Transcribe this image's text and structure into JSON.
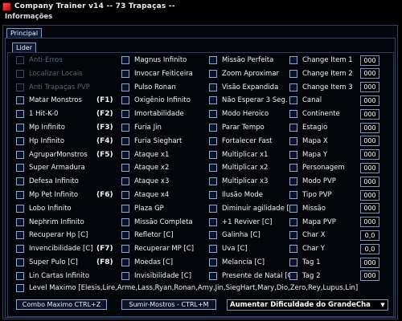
{
  "window": {
    "title": "Company Trainer v14 -- 73 Trapaças --"
  },
  "menu": {
    "info": "Informações"
  },
  "tabs": {
    "main": "Principal",
    "sub": "Lider"
  },
  "col1": [
    {
      "label": "Anti-Erros",
      "hotkey": "",
      "disabled": true
    },
    {
      "label": "Localizar Locais",
      "hotkey": "",
      "disabled": true
    },
    {
      "label": "Anti Trapaças PVP",
      "hotkey": "",
      "disabled": true
    },
    {
      "label": "Matar Monstros",
      "hotkey": "(F1)",
      "disabled": false
    },
    {
      "label": "1 Hit-K-0",
      "hotkey": "(F2)",
      "disabled": false
    },
    {
      "label": "Mp Infinito",
      "hotkey": "(F3)",
      "disabled": false
    },
    {
      "label": "Hp Infinito",
      "hotkey": "(F4)",
      "disabled": false
    },
    {
      "label": "AgruparMonstros",
      "hotkey": "(F5)",
      "disabled": false
    },
    {
      "label": "Super Armadura",
      "hotkey": "",
      "disabled": false
    },
    {
      "label": "Defesa Infinito",
      "hotkey": "",
      "disabled": false
    },
    {
      "label": "Mp Pet Infinito",
      "hotkey": "(F6)",
      "disabled": false
    },
    {
      "label": "Lobo Infinito",
      "hotkey": "",
      "disabled": false
    },
    {
      "label": "Nephrim Infinito",
      "hotkey": "",
      "disabled": false
    },
    {
      "label": "Recuperar Hp [C]",
      "hotkey": "",
      "disabled": false
    },
    {
      "label": "Invencibilidade [C]",
      "hotkey": "(F7)",
      "disabled": false
    },
    {
      "label": "Super Pulo [C]",
      "hotkey": "(F8)",
      "disabled": false
    },
    {
      "label": "Lin Cartas Infinito",
      "hotkey": "",
      "disabled": false
    }
  ],
  "col2": [
    "Magnus Infinito",
    "Invocar Feiticeira",
    "Pulso Ronan",
    "Oxigênio Infinito",
    "Imortabilidade",
    "Furia Jin",
    "Furia Sieghart",
    "Ataque x1",
    "Ataque x2",
    "Ataque x3",
    "Ataque x4",
    "Plaza GP",
    "Missão Completa",
    "Refletor [C]",
    "Recuperar MP [C]",
    "Moedas [C]",
    "Invisibilidade [C]"
  ],
  "col3": [
    "Missão Perfeita",
    "Zoom Aproximar",
    "Visão Expandida",
    "Não Esperar 3 Seg.",
    "Modo Heroico",
    "Parar Tempo",
    "Fortalecer Fast",
    "Multiplicar x1",
    "Multiplicar x2",
    "Multiplicar x3",
    "Ilusão Mode",
    "Diminuir agilidade [C]",
    "+1 Reviver [C]",
    "Galinha [C]",
    "Uva [C]",
    "Melancia [C]",
    "Presente de Natal [C]"
  ],
  "col4": [
    {
      "label": "Change Item 1",
      "value": "000"
    },
    {
      "label": "Change Item 2",
      "value": "000"
    },
    {
      "label": "Change Item 3",
      "value": "000"
    },
    {
      "label": "Canal",
      "value": "000"
    },
    {
      "label": "Continente",
      "value": "000"
    },
    {
      "label": "Estagio",
      "value": "000"
    },
    {
      "label": "Mapa X",
      "value": "000"
    },
    {
      "label": "Mapa Y",
      "value": "000"
    },
    {
      "label": "Personagem",
      "value": "000"
    },
    {
      "label": "Modo PVP",
      "value": "000"
    },
    {
      "label": "Tipo PVP",
      "value": "000"
    },
    {
      "label": "Missão",
      "value": "000"
    },
    {
      "label": "Mapa PVP",
      "value": "000"
    },
    {
      "label": "Char X",
      "value": "0,0"
    },
    {
      "label": "Char Y",
      "value": "0,0"
    },
    {
      "label": "Tag 1",
      "value": "000"
    },
    {
      "label": "Tag 2",
      "value": "000"
    }
  ],
  "level_max": {
    "label": "Level Maximo [Elesis,Lire,Arme,Lass,Ryan,Ronan,Amy,Jin,SiegHart,Mary,Dio,Zero,Rey,Lupus,Lin]"
  },
  "buttons": {
    "combo": "Combo Maximo  CTRL+Z",
    "sumir": "Sumir-Mostros - CTRL+M"
  },
  "dropdown": {
    "selected": "Aumentar Dificuldade do GrandeCha"
  },
  "colors": {
    "background": "#000000",
    "border": "#8fa7d2",
    "text": "#f2f2f2",
    "disabled_text": "#5a6478"
  }
}
